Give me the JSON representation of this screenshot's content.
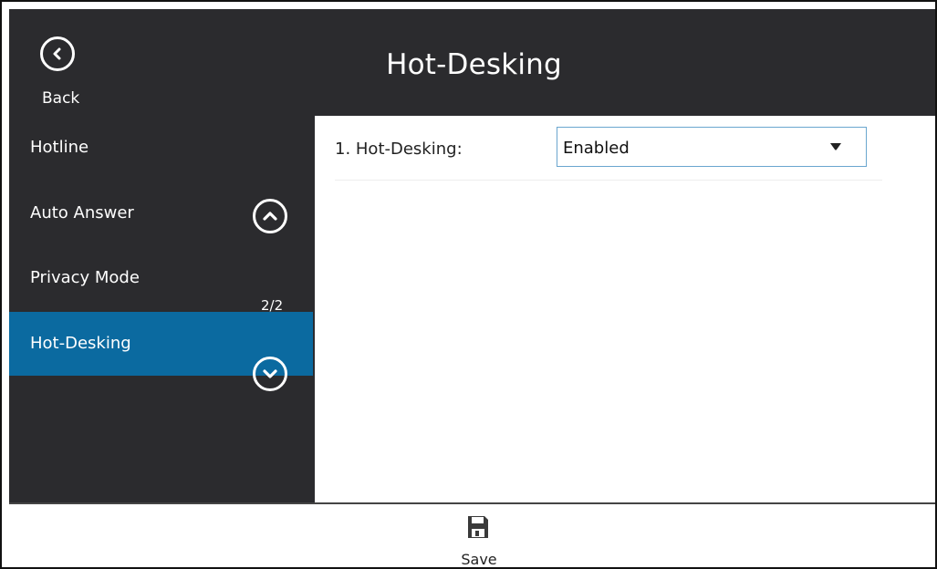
{
  "header": {
    "title": "Hot-Desking",
    "back_label": "Back"
  },
  "sidebar": {
    "items": [
      {
        "label": "Hotline",
        "active": false
      },
      {
        "label": "Auto Answer",
        "active": false
      },
      {
        "label": "Privacy Mode",
        "active": false
      },
      {
        "label": "Hot-Desking",
        "active": true
      }
    ],
    "page_indicator": "2/2",
    "scroll_up_icon": "chevron-up-icon",
    "scroll_down_icon": "chevron-down-icon"
  },
  "content": {
    "settings": [
      {
        "label": "1. Hot-Desking:",
        "value": "Enabled"
      }
    ]
  },
  "footer": {
    "save_label": "Save",
    "save_icon": "floppy-disk-icon"
  },
  "colors": {
    "header_bg": "#2b2b2e",
    "active_item_bg": "#0b6aa0",
    "select_border": "#6aa6cf"
  }
}
